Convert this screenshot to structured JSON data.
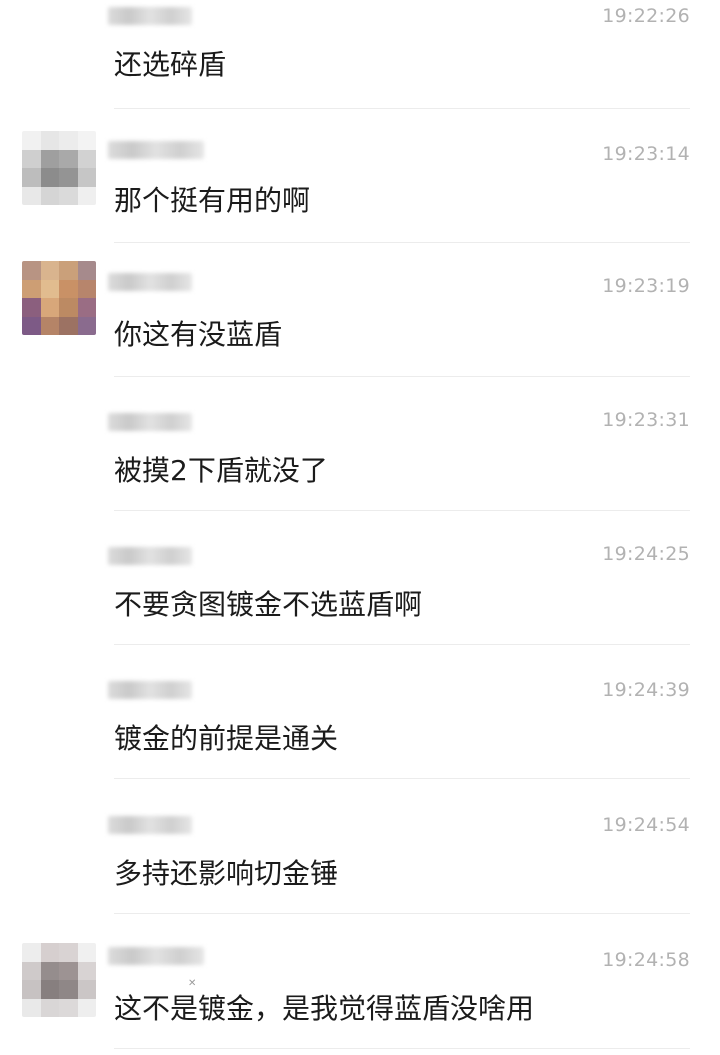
{
  "messages": [
    {
      "time": "19:22:26",
      "text": "还选碎盾",
      "avatar": false
    },
    {
      "time": "19:23:14",
      "text": "那个挺有用的啊",
      "avatar": "grey"
    },
    {
      "time": "19:23:19",
      "text": "你这有没蓝盾",
      "avatar": "warm"
    },
    {
      "time": "19:23:31",
      "text": "被摸2下盾就没了",
      "avatar": false
    },
    {
      "time": "19:24:25",
      "text": "不要贪图镀金不选蓝盾啊",
      "avatar": false
    },
    {
      "time": "19:24:39",
      "text": "镀金的前提是通关",
      "avatar": false
    },
    {
      "time": "19:24:54",
      "text": "多持还影响切金锤",
      "avatar": false
    },
    {
      "time": "19:24:58",
      "text": "这不是镀金，是我觉得蓝盾没啥用",
      "avatar": "grey"
    }
  ],
  "colors": {
    "time": "#b2b2b2",
    "text": "#1b1b1b",
    "divider": "#ececec"
  }
}
